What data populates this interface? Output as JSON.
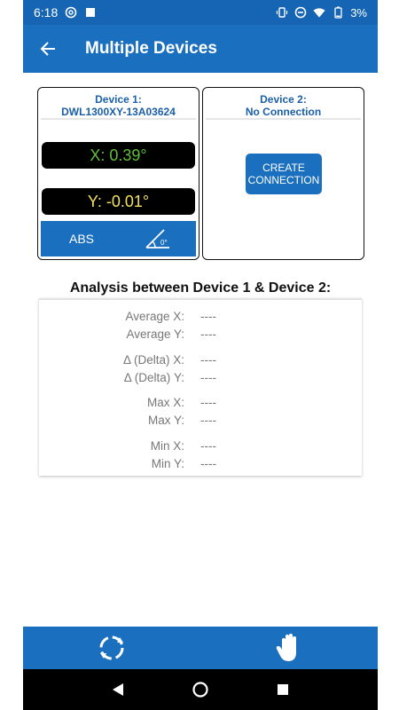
{
  "status_bar": {
    "time": "6:18",
    "battery": "3%",
    "icons": [
      "at-icon",
      "square-icon",
      "vibrate-icon",
      "dnd-icon",
      "wifi-icon",
      "battery-icon"
    ]
  },
  "app_bar": {
    "title": "Multiple Devices",
    "back_icon": "arrow-left-icon"
  },
  "device1": {
    "title": "Device 1:",
    "serial": "DWL1300XY-13A03624",
    "x_reading": "X: 0.39°",
    "y_reading": "Y: -0.01°",
    "mode_label": "ABS",
    "mode_icon_text": "0°"
  },
  "device2": {
    "title": "Device 2:",
    "status": "No Connection",
    "button_line1": "CREATE",
    "button_line2": "CONNECTION"
  },
  "analysis": {
    "title": "Analysis between Device 1 & Device 2:",
    "rows": [
      {
        "label": "Average X:",
        "value": "----"
      },
      {
        "label": "Average Y:",
        "value": "----"
      },
      {
        "label": "Δ (Delta) X:",
        "value": "----"
      },
      {
        "label": "Δ (Delta) Y:",
        "value": "----"
      },
      {
        "label": "Max X:",
        "value": "----"
      },
      {
        "label": "Max Y:",
        "value": "----"
      },
      {
        "label": "Min X:",
        "value": "----"
      },
      {
        "label": "Min Y:",
        "value": "----"
      }
    ]
  },
  "colors": {
    "primary": "#1b6fbf",
    "status_bar": "#1565b4",
    "x_reading": "#5fbf3a",
    "y_reading": "#f3e25a"
  },
  "bottom_bar": {
    "left_icon": "rotate-icon",
    "right_icon": "hand-icon"
  }
}
